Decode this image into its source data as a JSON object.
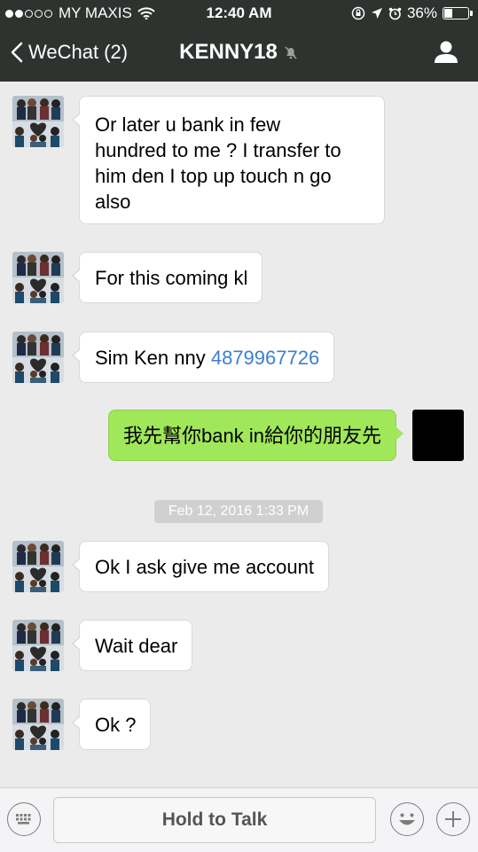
{
  "status_bar": {
    "carrier": "MY MAXIS",
    "time": "12:40 AM",
    "battery": "36%",
    "battery_level": 0.36
  },
  "nav": {
    "back_label": "WeChat (2)",
    "title": "KENNY18"
  },
  "messages": [
    {
      "side": "in",
      "lines": [
        "Or later u bank in few",
        "hundred to me ? I transfer to",
        "him den I top up touch n go",
        "also"
      ]
    },
    {
      "side": "in",
      "text": "For this coming kl"
    },
    {
      "side": "in",
      "text_prefix": "Sim Ken nny ",
      "link": "4879967726"
    },
    {
      "side": "out",
      "text": "我先幫你bank in給你的朋友先"
    },
    {
      "side": "in",
      "text": "Ok I ask give me account"
    },
    {
      "side": "in",
      "text": "Wait dear"
    },
    {
      "side": "in",
      "text": "Ok ?"
    }
  ],
  "timestamp": "Feb 12, 2016 1:33 PM",
  "input_bar": {
    "hold_to_talk": "Hold to Talk",
    "keyboard_icon": "keyboard-icon",
    "emoji_icon": "smiley-icon",
    "add_icon": "plus-icon"
  },
  "colors": {
    "header_bg": "#2f3330",
    "chat_bg": "#ebebeb",
    "outgoing_bubble": "#a0e75a",
    "link": "#3b7fd0"
  }
}
